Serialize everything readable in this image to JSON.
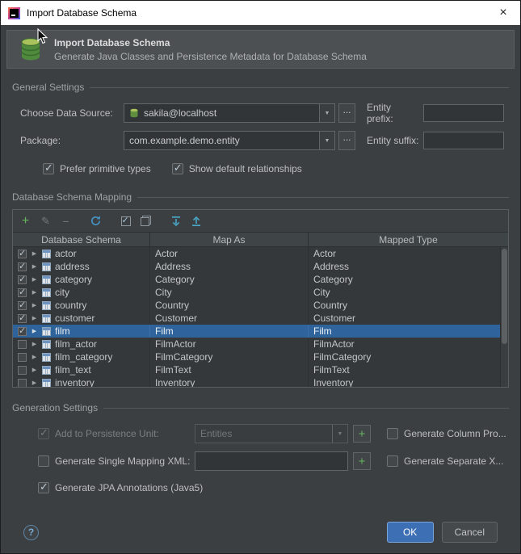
{
  "window": {
    "title": "Import Database Schema"
  },
  "icons": {
    "close": "×",
    "dropdown": "▼",
    "row_expand": "▶",
    "add": "+",
    "edit": "✎",
    "remove": "−",
    "browse": "..."
  },
  "banner": {
    "title": "Import Database Schema",
    "subtitle": "Generate Java Classes and Persistence Metadata for Database Schema"
  },
  "general": {
    "section_label": "General Settings",
    "data_source_label": "Choose Data Source:",
    "data_source_value": "sakila@localhost",
    "package_label": "Package:",
    "package_value": "com.example.demo.entity",
    "entity_prefix_label": "Entity prefix:",
    "entity_prefix_value": "",
    "entity_suffix_label": "Entity suffix:",
    "entity_suffix_value": "",
    "prefer_primitive_label": "Prefer primitive types",
    "prefer_primitive_checked": true,
    "show_default_label": "Show default relationships",
    "show_default_checked": true
  },
  "mapping": {
    "section_label": "Database Schema Mapping",
    "toolbar_icons": [
      "add-icon",
      "edit-icon",
      "remove-icon",
      "refresh-icon",
      "select-all-icon",
      "unselect-all-icon",
      "expand-all-icon",
      "collapse-all-icon"
    ],
    "columns": [
      "Database Schema",
      "Map As",
      "Mapped Type"
    ],
    "rows": [
      {
        "checked": true,
        "selected": false,
        "name": "actor",
        "map_as": "Actor",
        "mapped_type": "Actor"
      },
      {
        "checked": true,
        "selected": false,
        "name": "address",
        "map_as": "Address",
        "mapped_type": "Address"
      },
      {
        "checked": true,
        "selected": false,
        "name": "category",
        "map_as": "Category",
        "mapped_type": "Category"
      },
      {
        "checked": true,
        "selected": false,
        "name": "city",
        "map_as": "City",
        "mapped_type": "City"
      },
      {
        "checked": true,
        "selected": false,
        "name": "country",
        "map_as": "Country",
        "mapped_type": "Country"
      },
      {
        "checked": true,
        "selected": false,
        "name": "customer",
        "map_as": "Customer",
        "mapped_type": "Customer"
      },
      {
        "checked": true,
        "selected": true,
        "name": "film",
        "map_as": "Film",
        "mapped_type": "Film"
      },
      {
        "checked": false,
        "selected": false,
        "name": "film_actor",
        "map_as": "FilmActor",
        "mapped_type": "FilmActor"
      },
      {
        "checked": false,
        "selected": false,
        "name": "film_category",
        "map_as": "FilmCategory",
        "mapped_type": "FilmCategory"
      },
      {
        "checked": false,
        "selected": false,
        "name": "film_text",
        "map_as": "FilmText",
        "mapped_type": "FilmText"
      },
      {
        "checked": false,
        "selected": false,
        "name": "inventory",
        "map_as": "Inventory",
        "mapped_type": "Inventory"
      }
    ]
  },
  "generation": {
    "section_label": "Generation Settings",
    "persistence_label": "Add to Persistence Unit:",
    "persistence_value": "Entities",
    "persistence_checked": true,
    "column_props_label": "Generate Column Pro...",
    "column_props_checked": false,
    "single_xml_label": "Generate Single Mapping XML:",
    "single_xml_value": "",
    "single_xml_checked": false,
    "separate_xml_label": "Generate Separate X...",
    "separate_xml_checked": false,
    "jpa_label": "Generate JPA Annotations (Java5)",
    "jpa_checked": true
  },
  "footer": {
    "help_label": "?",
    "ok_label": "OK",
    "cancel_label": "Cancel"
  },
  "colors": {
    "dialog_bg": "#3c3f41",
    "titlebar_bg": "#ffffff",
    "banner_bg": "#4c5052",
    "selection_blue": "#2e639c",
    "ok_button_blue": "#3d6fb5",
    "accent_green": "#65b25f",
    "refresh_blue": "#4596c8"
  }
}
